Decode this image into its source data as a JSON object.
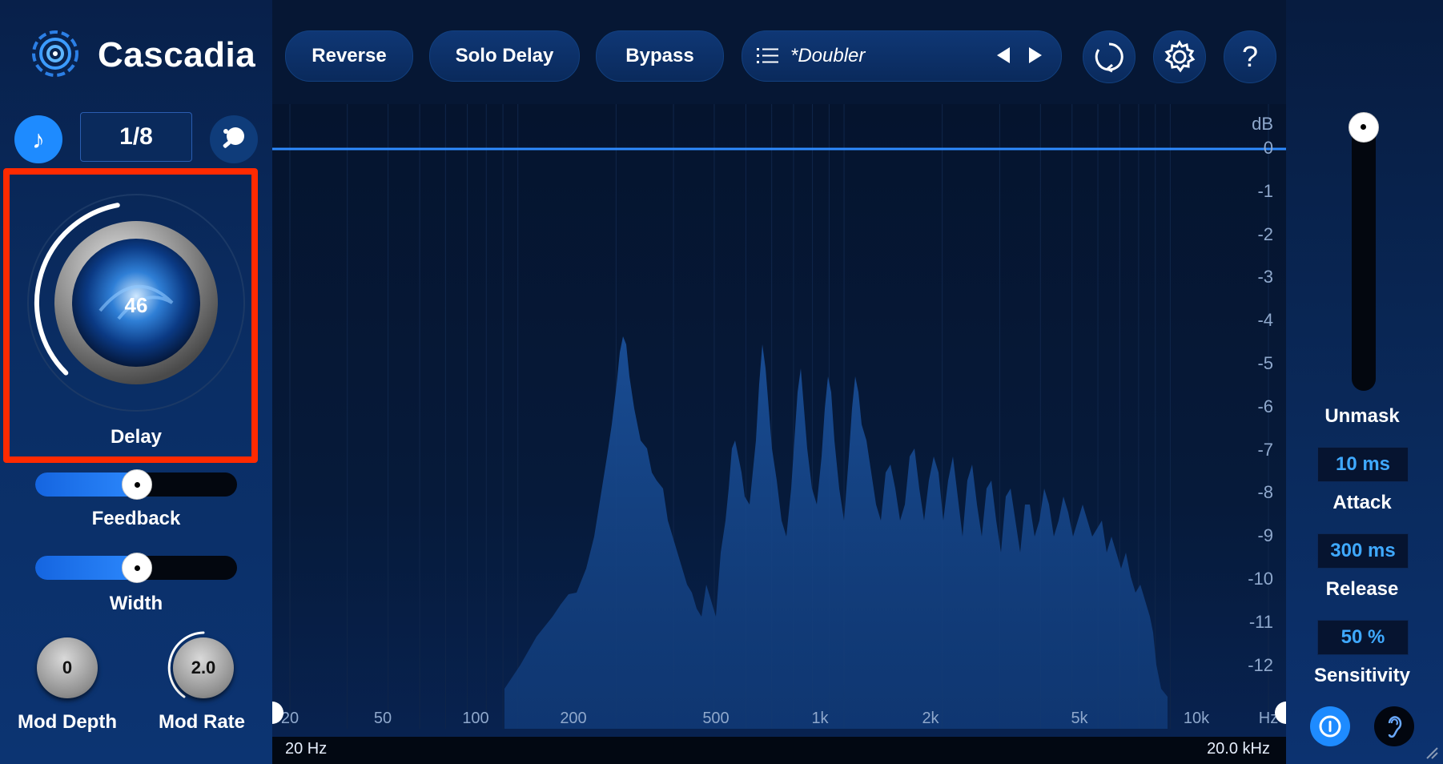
{
  "app": {
    "title": "Cascadia"
  },
  "toolbar": {
    "reverse_label": "Reverse",
    "solo_delay_label": "Solo Delay",
    "bypass_label": "Bypass",
    "preset_name": "*Doubler"
  },
  "sync": {
    "division": "1/8"
  },
  "delay_knob": {
    "value": "46",
    "label": "Delay",
    "level": 0.46
  },
  "feedback": {
    "label": "Feedback",
    "level": 0.5
  },
  "width": {
    "label": "Width",
    "level": 0.5
  },
  "mod_depth": {
    "value": "0",
    "label": "Mod Depth"
  },
  "mod_rate": {
    "value": "2.0",
    "label": "Mod Rate"
  },
  "unmask": {
    "label": "Unmask",
    "level": 1.0
  },
  "attack": {
    "value": "10 ms",
    "label": "Attack"
  },
  "release": {
    "value": "300 ms",
    "label": "Release"
  },
  "sensitivity": {
    "value": "50 %",
    "label": "Sensitivity"
  },
  "graph": {
    "y_unit": "dB",
    "y_ticks": [
      "0",
      "-1",
      "-2",
      "-3",
      "-4",
      "-5",
      "-6",
      "-7",
      "-8",
      "-9",
      "-10",
      "-11",
      "-12"
    ],
    "x_ticks": [
      "20",
      "50",
      "100",
      "200",
      "500",
      "1k",
      "2k",
      "5k",
      "10k",
      "Hz"
    ],
    "range_start": "20 Hz",
    "range_end": "20.0 kHz"
  },
  "colors": {
    "accent": "#2e8bff",
    "highlight": "#ff2a00",
    "background": "#04122a"
  },
  "icons": [
    "cascadia-logo-icon",
    "note-icon",
    "ping-pong-icon",
    "list-icon",
    "prev-icon",
    "next-icon",
    "reset-icon",
    "gear-icon",
    "help-icon",
    "waves-icon",
    "ni-logo-icon",
    "power-icon",
    "ear-icon"
  ]
}
